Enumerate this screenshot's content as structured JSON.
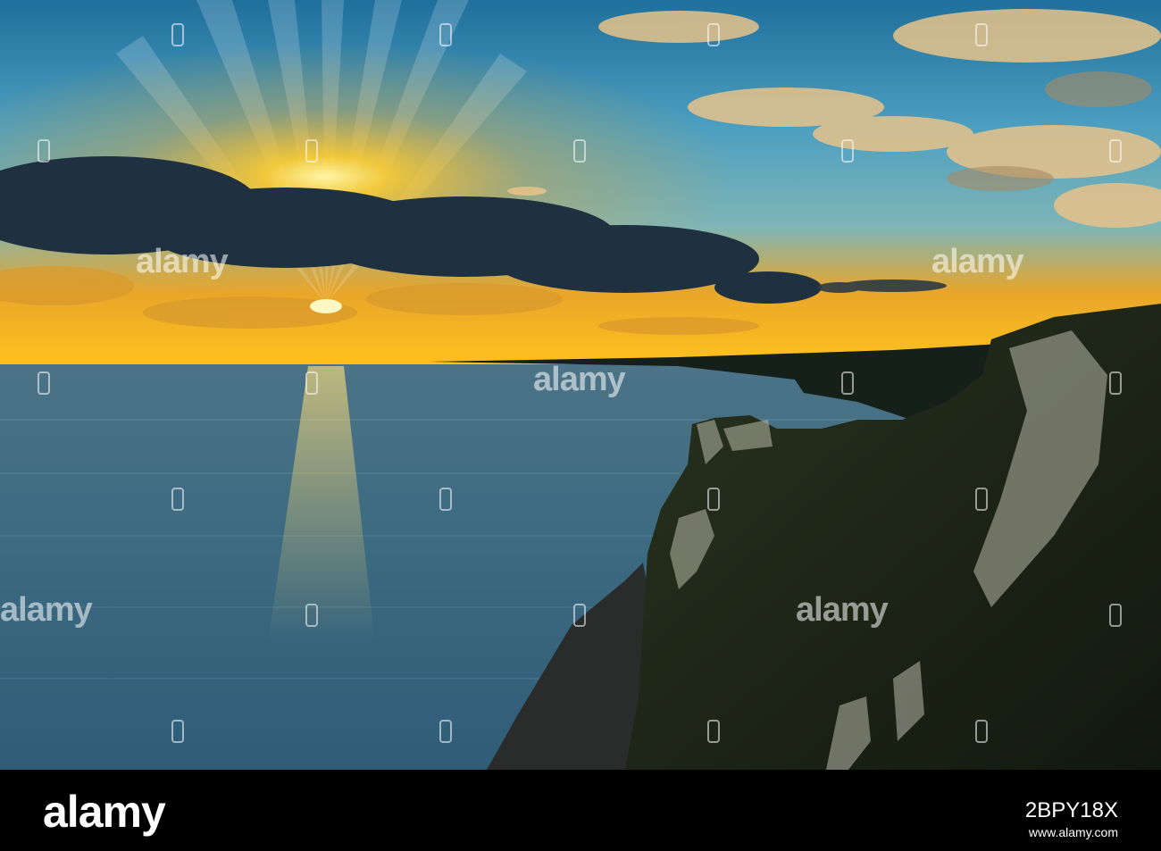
{
  "scene": {
    "description_colors": {
      "sky_top": "#2f7fa8",
      "sky_mid": "#6fb6cf",
      "sun_glow": "#ffbf1f",
      "sea": "#3e6f87",
      "cliff": "#1d2615"
    }
  },
  "watermark": {
    "text": "alamy"
  },
  "footer": {
    "brand": "alamy",
    "image_id": "2BPY18X",
    "website": "www.alamy.com"
  }
}
